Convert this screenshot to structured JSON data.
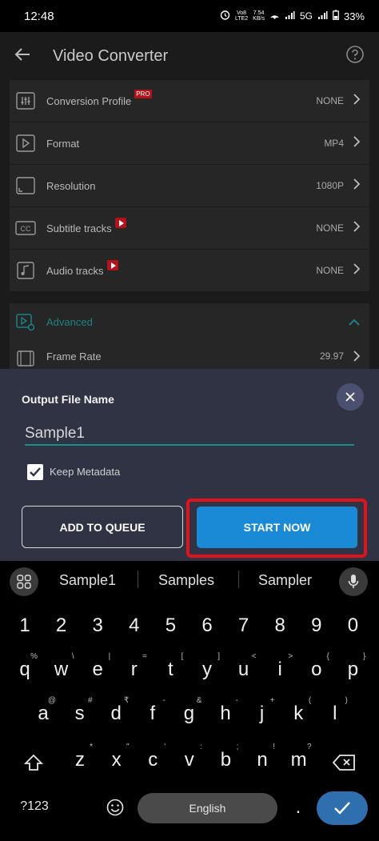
{
  "status_bar": {
    "time": "12:48",
    "volte": "Vo8",
    "lte": "LTE2",
    "speed": "7.54",
    "speed_unit": "KB/s",
    "network": "5G",
    "battery": "33%"
  },
  "app": {
    "title": "Video Converter",
    "rows": [
      {
        "label": "Conversion Profile",
        "value": "NONE",
        "badge": "PRO"
      },
      {
        "label": "Format",
        "value": "MP4"
      },
      {
        "label": "Resolution",
        "value": "1080P"
      },
      {
        "label": "Subtitle tracks",
        "value": "NONE"
      },
      {
        "label": "Audio tracks",
        "value": "NONE"
      }
    ],
    "advanced_label": "Advanced",
    "frame_rate": {
      "label": "Frame Rate",
      "value": "29.97"
    },
    "accent_color": "#1e7f86"
  },
  "sheet": {
    "title": "Output File Name",
    "file_name": "Sample1",
    "keep_metadata_label": "Keep Metadata",
    "keep_metadata_checked": true,
    "add_to_queue_label": "ADD TO QUEUE",
    "start_now_label": "START NOW",
    "start_color": "#1a8ad6",
    "highlight_color": "#e0121a"
  },
  "keyboard": {
    "suggestions": [
      "Sample1",
      "Samples",
      "Sampler"
    ],
    "numbers": [
      "1",
      "2",
      "3",
      "4",
      "5",
      "6",
      "7",
      "8",
      "9",
      "0"
    ],
    "row1": [
      {
        "k": "q",
        "s": "%"
      },
      {
        "k": "w",
        "s": "\\"
      },
      {
        "k": "e",
        "s": "|"
      },
      {
        "k": "r",
        "s": "="
      },
      {
        "k": "t",
        "s": "["
      },
      {
        "k": "y",
        "s": "]"
      },
      {
        "k": "u",
        "s": "<"
      },
      {
        "k": "i",
        "s": ">"
      },
      {
        "k": "o",
        "s": "{"
      },
      {
        "k": "p",
        "s": "}"
      }
    ],
    "row2": [
      {
        "k": "a",
        "s": "@"
      },
      {
        "k": "s",
        "s": "#"
      },
      {
        "k": "d",
        "s": "₹"
      },
      {
        "k": "f",
        "s": "-"
      },
      {
        "k": "g",
        "s": "&"
      },
      {
        "k": "h",
        "s": "-"
      },
      {
        "k": "j",
        "s": "+"
      },
      {
        "k": "k",
        "s": "("
      },
      {
        "k": "l",
        "s": ")"
      }
    ],
    "row3": [
      {
        "k": "z",
        "s": "*"
      },
      {
        "k": "x",
        "s": "\""
      },
      {
        "k": "c",
        "s": "'"
      },
      {
        "k": "v",
        "s": ":"
      },
      {
        "k": "b",
        "s": ";"
      },
      {
        "k": "n",
        "s": "!"
      },
      {
        "k": "m",
        "s": "?"
      }
    ],
    "symbols_label": "?123",
    "space_label": "English",
    "period": "."
  }
}
